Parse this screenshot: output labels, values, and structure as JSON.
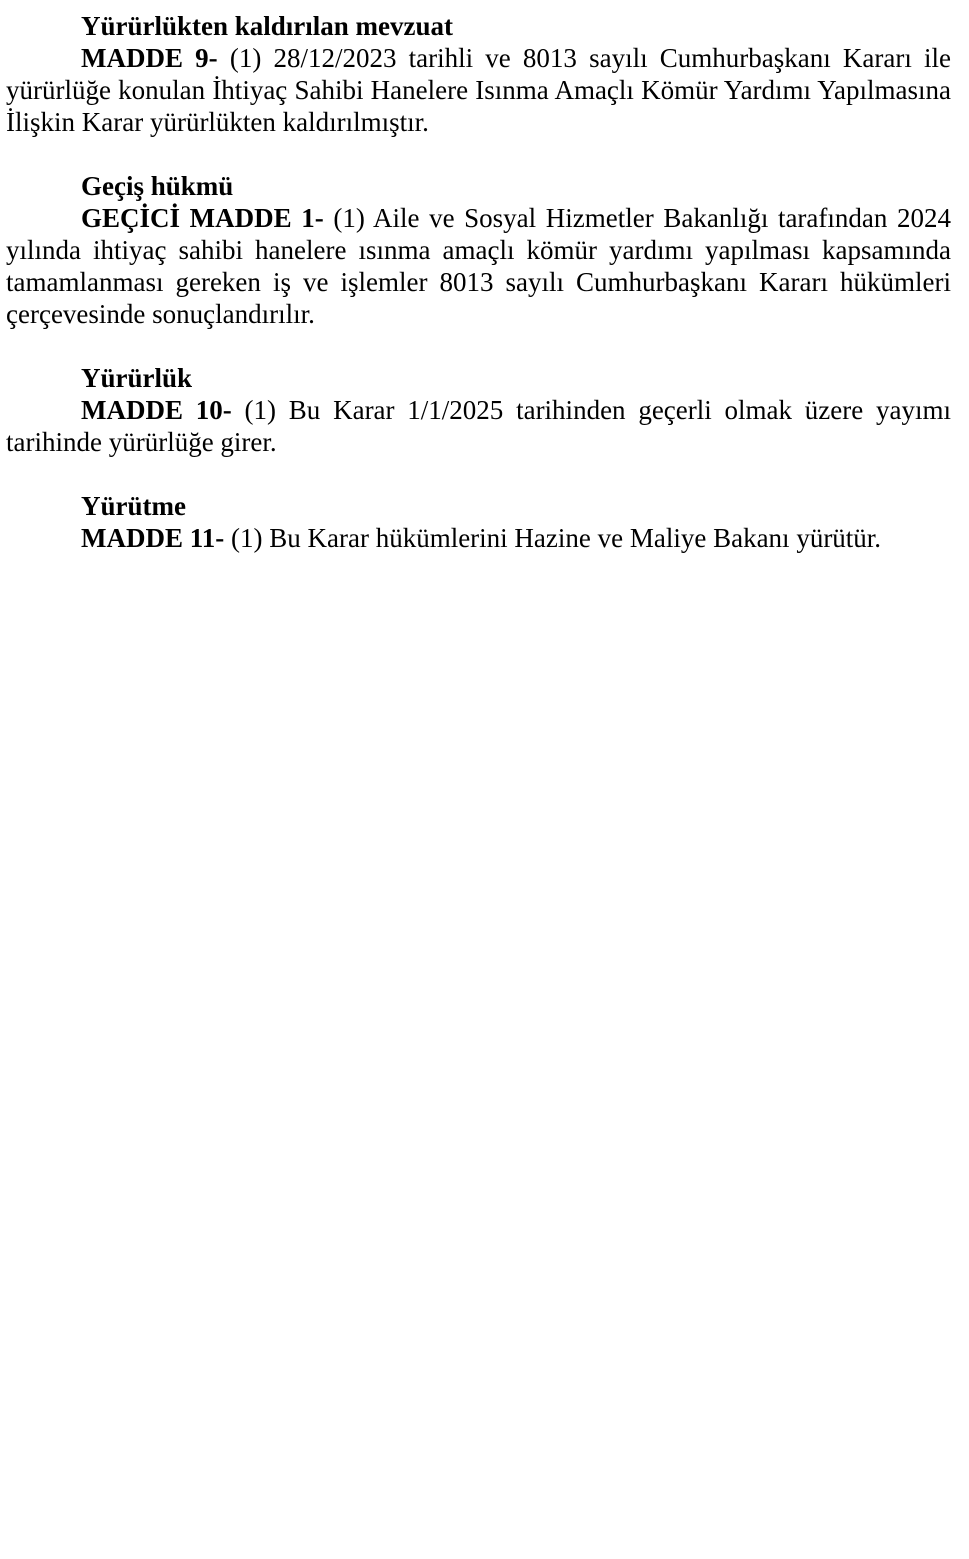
{
  "sections": [
    {
      "heading": "Yürürlükten kaldırılan mevzuat",
      "article": "MADDE 9-",
      "text": "(1) 28/12/2023 tarihli ve 8013 sayılı Cumhurbaşkanı Kararı ile yürürlüğe konulan İhtiyaç Sahibi Hanelere Isınma Amaçlı Kömür Yardımı Yapılmasına İlişkin Karar yürürlükten kaldırılmıştır."
    },
    {
      "heading": "Geçiş hükmü",
      "article": "GEÇİCİ MADDE 1-",
      "text": "(1) Aile ve Sosyal Hizmetler Bakanlığı tarafından 2024 yılında ihtiyaç sahibi hanelere ısınma amaçlı kömür yardımı yapılması kapsamında tamamlanması gereken iş ve işlemler 8013 sayılı Cumhurbaşkanı Kararı hükümleri çerçevesinde sonuçlandırılır."
    },
    {
      "heading": "Yürürlük",
      "article": "MADDE 10-",
      "text": "(1) Bu Karar 1/1/2025 tarihinden geçerli olmak üzere yayımı tarihinde yürürlüğe girer."
    },
    {
      "heading": "Yürütme",
      "article": "MADDE 11-",
      "text": "(1) Bu Karar hükümlerini Hazine ve Maliye Bakanı yürütür."
    }
  ]
}
